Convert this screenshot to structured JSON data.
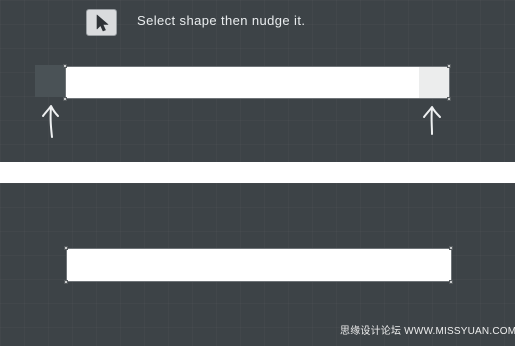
{
  "toolbar": {
    "tool_icon": "selection-arrow-icon",
    "instruction": "Select shape then nudge it."
  },
  "colors": {
    "panel_background": "#3d4347",
    "shape_fill": "#ffffff",
    "shape_border": "#6f7478",
    "ghost_dark": "#4a5256",
    "ghost_light": "#e7e8e9",
    "text": "#e9ecee"
  },
  "annotations": {
    "left_arrow_icon": "hand-drawn-up-arrow-icon",
    "right_arrow_icon": "hand-drawn-up-arrow-icon"
  },
  "watermark": {
    "text": "思缘设计论坛 WWW.MISSYUAN.COM"
  }
}
